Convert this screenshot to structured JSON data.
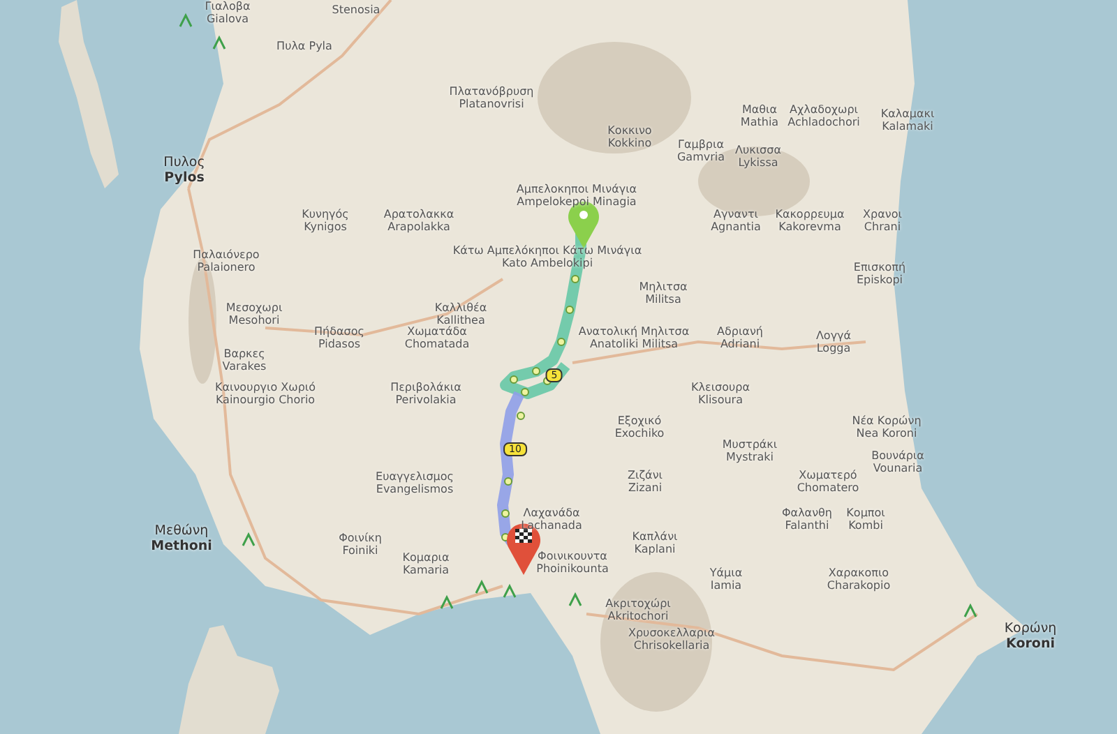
{
  "map": {
    "places": [
      {
        "local": "Γιαλοβα",
        "latin": "Gialova",
        "kind": "village"
      },
      {
        "latin": "Stenosia",
        "kind": "village"
      },
      {
        "local": "Πυλα Pyla",
        "kind": "village"
      },
      {
        "local": "Πλατανόβρυση",
        "latin": "Platanovrisi",
        "kind": "village"
      },
      {
        "local": "Μαθια",
        "latin": "Mathia",
        "kind": "village"
      },
      {
        "local": "Αχλαδοχωρι",
        "latin": "Achladochori",
        "kind": "village"
      },
      {
        "local": "Καλαμακι",
        "latin": "Kalamaki",
        "kind": "village"
      },
      {
        "local": "Κοκκινο",
        "latin": "Kokkino",
        "kind": "village"
      },
      {
        "local": "Πυλος",
        "latin": "Pylos",
        "kind": "town"
      },
      {
        "local": "Γαμβρια",
        "latin": "Gamvria",
        "kind": "village"
      },
      {
        "local": "Λυκισσα",
        "latin": "Lykissa",
        "kind": "village"
      },
      {
        "local": "Αμπελοκηποι Μινάγια",
        "latin": "Ampelokepoi Minagia",
        "kind": "village"
      },
      {
        "local": "Κυνηγός",
        "latin": "Kynigos",
        "kind": "village"
      },
      {
        "local": "Αρατολακκα",
        "latin": "Arapolakka",
        "kind": "village"
      },
      {
        "local": "Αγναντι",
        "latin": "Agnantia",
        "kind": "village"
      },
      {
        "local": "Κακορρευμα",
        "latin": "Kakorevma",
        "kind": "village"
      },
      {
        "local": "Χρανοι",
        "latin": "Chrani",
        "kind": "village"
      },
      {
        "local": "Παλαιόνερο",
        "latin": "Palaionero",
        "kind": "village"
      },
      {
        "local": "Κάτω Αμπελόκηποι Κάτω Μινάγια",
        "latin": "Kato Ambelokipi",
        "kind": "village"
      },
      {
        "local": "Επισκοπή",
        "latin": "Episkopi",
        "kind": "village"
      },
      {
        "local": "Μηλιτσα",
        "latin": "Militsa",
        "kind": "village"
      },
      {
        "local": "Μεσοχωρι",
        "latin": "Mesohori",
        "kind": "village"
      },
      {
        "local": "Καλλιθέα",
        "latin": "Kallithea",
        "kind": "village"
      },
      {
        "local": "Πήδασος",
        "latin": "Pidasos",
        "kind": "village"
      },
      {
        "local": "Χωματάδα",
        "latin": "Chomatada",
        "kind": "village"
      },
      {
        "local": "Ανατολική Μηλιτσα",
        "latin": "Anatoliki Militsa",
        "kind": "village"
      },
      {
        "local": "Αδριανή",
        "latin": "Adriani",
        "kind": "village"
      },
      {
        "local": "Λογγά",
        "latin": "Logga",
        "kind": "village"
      },
      {
        "local": "Βαρκες",
        "latin": "Varakes",
        "kind": "village"
      },
      {
        "local": "Καινουργιο Χωριό",
        "latin": "Kainourgio Chorio",
        "kind": "village"
      },
      {
        "local": "Περιβολάκια",
        "latin": "Perivolakia",
        "kind": "village"
      },
      {
        "local": "Κλεισουρα",
        "latin": "Klisoura",
        "kind": "village"
      },
      {
        "local": "Εξοχικό",
        "latin": "Exochiko",
        "kind": "village"
      },
      {
        "local": "Νέα Κορώνη",
        "latin": "Nea Koroni",
        "kind": "village"
      },
      {
        "local": "Μυστράκι",
        "latin": "Mystraki",
        "kind": "village"
      },
      {
        "local": "Βουνάρια",
        "latin": "Vounaria",
        "kind": "village"
      },
      {
        "local": "Ευαγγελισμος",
        "latin": "Evangelismos",
        "kind": "village"
      },
      {
        "local": "Ζιζάνι",
        "latin": "Zizani",
        "kind": "village"
      },
      {
        "local": "Χωματερό",
        "latin": "Chomatero",
        "kind": "village"
      },
      {
        "local": "Λαχανάδα",
        "latin": "Lachanada",
        "kind": "village"
      },
      {
        "local": "Φαλανθη",
        "latin": "Falanthi",
        "kind": "village"
      },
      {
        "local": "Κομποι",
        "latin": "Kombi",
        "kind": "village"
      },
      {
        "local": "Μεθώνη",
        "latin": "Methoni",
        "kind": "town"
      },
      {
        "local": "Φοινίκη",
        "latin": "Foiniki",
        "kind": "village"
      },
      {
        "local": "Καπλάνι",
        "latin": "Kaplani",
        "kind": "village"
      },
      {
        "local": "Κομαρια",
        "latin": "Kamaria",
        "kind": "village"
      },
      {
        "local": "Φοινικουντα",
        "latin": "Phoinikounta",
        "kind": "village"
      },
      {
        "local": "Υάμια",
        "latin": "Iamia",
        "kind": "village"
      },
      {
        "local": "Χαρακοπιο",
        "latin": "Charakopio",
        "kind": "village"
      },
      {
        "local": "Ακριτοχώρι",
        "latin": "Akritochori",
        "kind": "village"
      },
      {
        "local": "Χρυσοκελλαρια",
        "latin": "Chrisokellaria",
        "kind": "village"
      },
      {
        "local": "Κορώνη",
        "latin": "Koroni",
        "kind": "town"
      }
    ],
    "route_badges": [
      "5",
      "10"
    ]
  }
}
